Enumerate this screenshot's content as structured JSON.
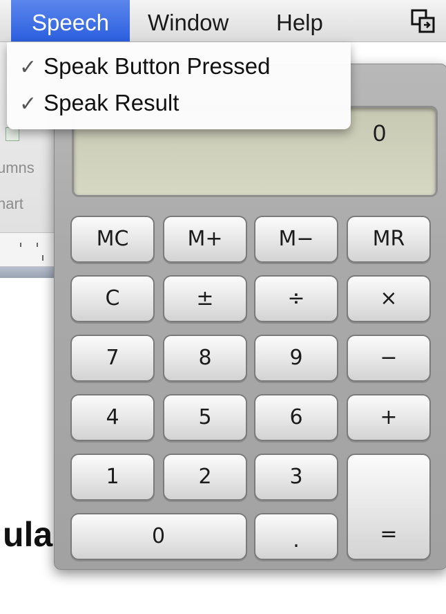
{
  "menubar": {
    "items": [
      "Speech",
      "Window",
      "Help"
    ],
    "extra_icon": "window-restore-icon"
  },
  "speech_menu": {
    "items": [
      {
        "label": "Speak Button Pressed",
        "checked": true
      },
      {
        "label": "Speak Result",
        "checked": true
      }
    ],
    "check_glyph": "✓"
  },
  "background_doc": {
    "labels": [
      "umns",
      "hart"
    ],
    "big_text": "ula"
  },
  "calculator": {
    "display": "0",
    "keys": {
      "mc": "MC",
      "mplus": "M+",
      "mminus": "M−",
      "mr": "MR",
      "c": "C",
      "plusminus": "±",
      "divide": "÷",
      "multiply": "×",
      "k7": "7",
      "k8": "8",
      "k9": "9",
      "minus": "−",
      "k4": "4",
      "k5": "5",
      "k6": "6",
      "plus": "+",
      "k1": "1",
      "k2": "2",
      "k3": "3",
      "k0": "0",
      "dot": ".",
      "equals": "="
    }
  },
  "colors": {
    "menu_highlight": "#3a6ee6",
    "display_lcd": "#cfd1bb",
    "body": "#a9a9a9"
  }
}
